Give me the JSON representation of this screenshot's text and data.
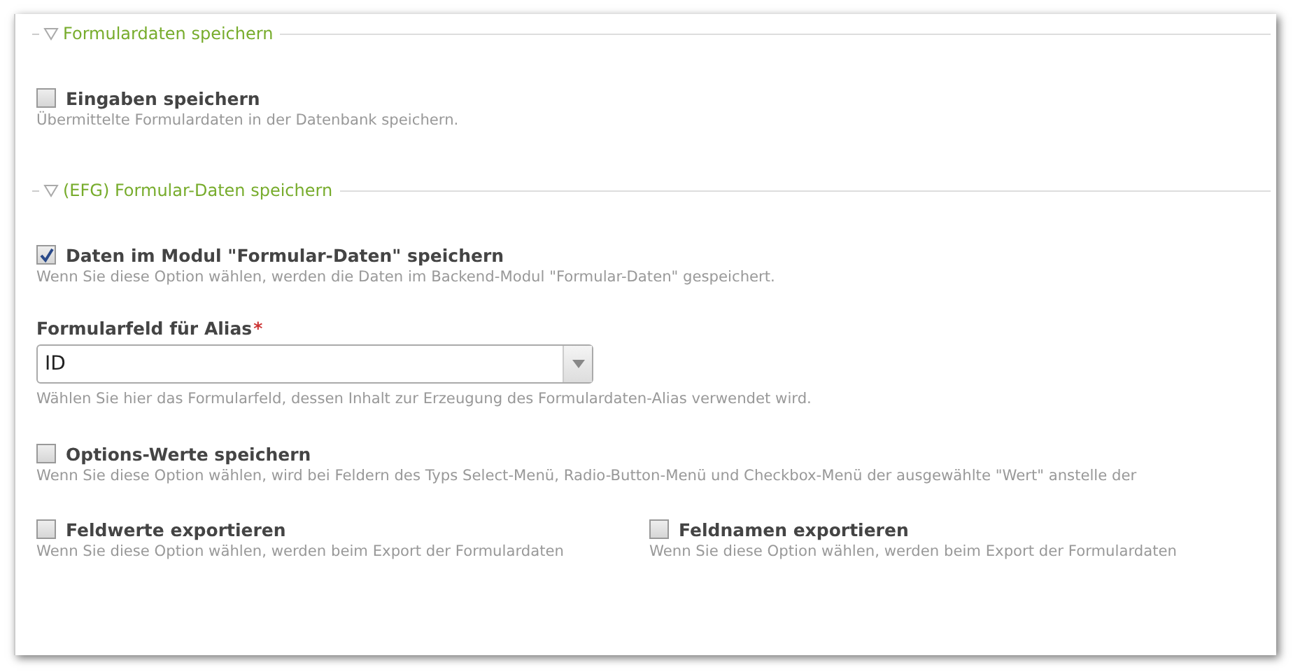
{
  "sections": [
    {
      "legend": "Formulardaten speichern",
      "expanded": true,
      "rows": [
        {
          "kind": "checkbox",
          "fields": [
            {
              "label": "Eingaben speichern",
              "checked": false,
              "help": "Übermittelte Formulardaten in der Datenbank speichern."
            }
          ]
        }
      ]
    },
    {
      "legend": "(EFG) Formular-Daten speichern",
      "expanded": true,
      "rows": [
        {
          "kind": "checkbox",
          "fields": [
            {
              "label": "Daten im Modul \"Formular-Daten\" speichern",
              "checked": true,
              "help": "Wenn Sie diese Option wählen, werden die Daten im Backend-Modul \"Formular-Daten\" gespeichert."
            }
          ]
        },
        {
          "kind": "select",
          "label": "Formularfeld für Alias",
          "required": true,
          "required_mark": "*",
          "value": "ID",
          "help": "Wählen Sie hier das Formularfeld, dessen Inhalt zur Erzeugung des Formulardaten-Alias verwendet wird."
        },
        {
          "kind": "checkbox",
          "fields": [
            {
              "label": "Options-Werte speichern",
              "checked": false,
              "help": "Wenn Sie diese Option wählen, wird bei Feldern des Typs Select-Menü, Radio-Button-Menü und Checkbox-Menü der ausgewählte \"Wert\" anstelle der"
            }
          ]
        },
        {
          "kind": "checkbox",
          "fields": [
            {
              "label": "Feldwerte exportieren",
              "checked": false,
              "help": "Wenn Sie diese Option wählen, werden beim Export der Formulardaten"
            },
            {
              "label": "Feldnamen exportieren",
              "checked": false,
              "help": "Wenn Sie diese Option wählen, werden beim Export der Formulardaten"
            }
          ]
        }
      ]
    }
  ]
}
